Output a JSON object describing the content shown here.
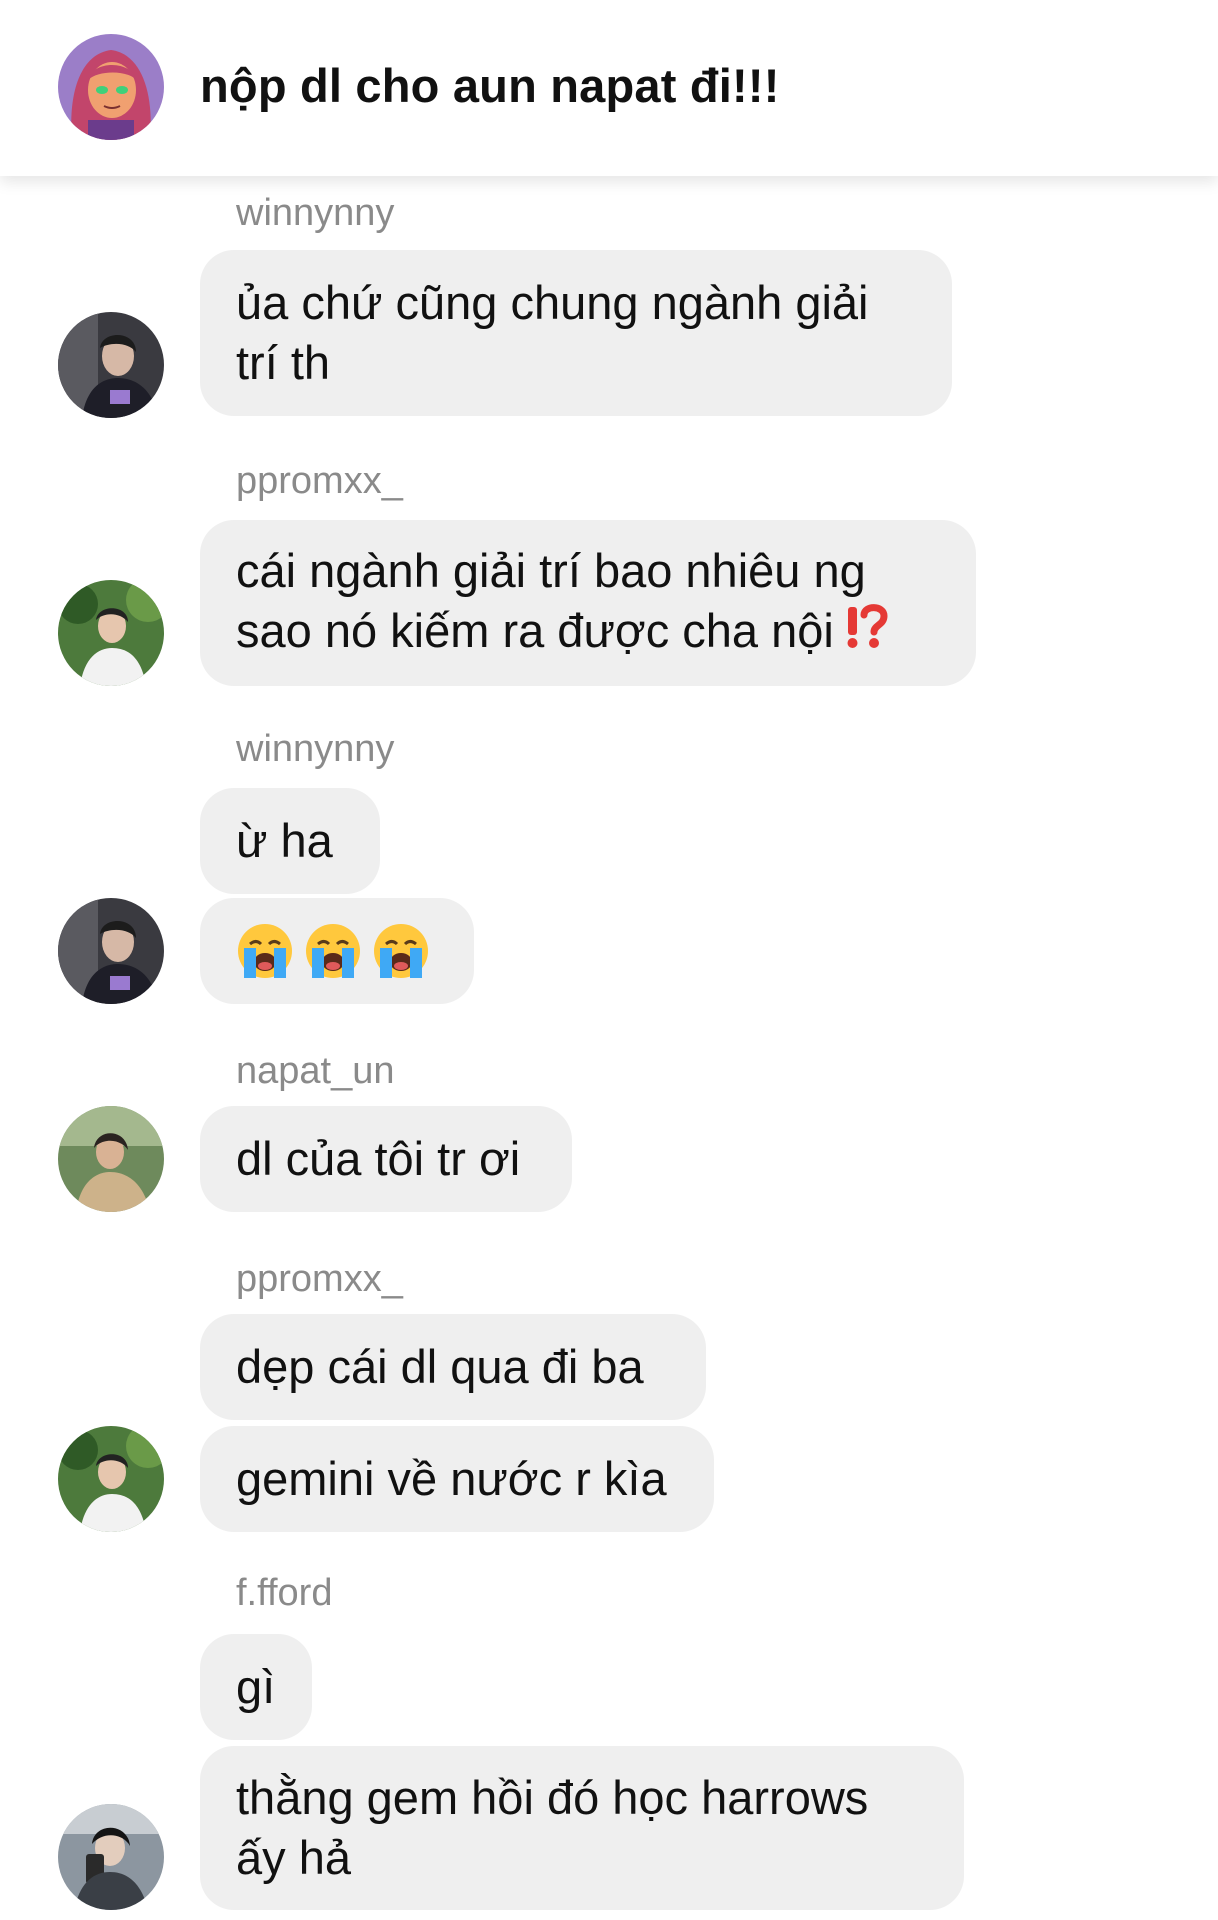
{
  "header": {
    "title": "nộp dl cho aun napat đi!!!"
  },
  "messages": [
    {
      "user": "winnynny",
      "lines": [
        "ủa chứ cũng chung ngành giải\ntrí th"
      ]
    },
    {
      "user": "ppromxx_",
      "lines": [
        "cái ngành giải trí bao nhiêu ng\nsao nó kiếm ra được cha nội"
      ]
    },
    {
      "user": "winnynny",
      "lines": [
        "ừ ha"
      ]
    },
    {
      "user": "napat_un",
      "lines": [
        "dl của tôi tr ơi"
      ]
    },
    {
      "user": "ppromxx_",
      "lines": [
        "dẹp cái dl qua đi ba",
        "gemini về nước r kìa"
      ]
    },
    {
      "user": "f.fford",
      "lines": [
        "gì",
        "thằng gem hồi đó học harrows\nấy hả"
      ]
    }
  ],
  "icons": {
    "header_avatar": "starfire-avatar-icon",
    "interrobang": "exclamation-question-icon",
    "crying": "loudly-crying-face-icon"
  },
  "colors": {
    "bubble": "#efefef",
    "username": "#8a8a8a",
    "interrobang": "#e53935",
    "header_avatar_bg": "#9b7ec8"
  }
}
